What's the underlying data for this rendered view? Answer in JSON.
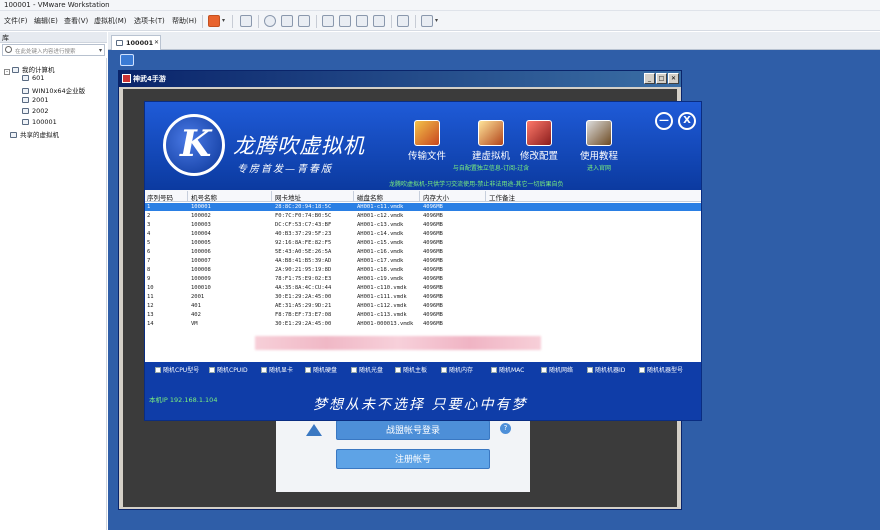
{
  "window": {
    "title": "100001 - VMware Workstation"
  },
  "menu": [
    "文件(F)",
    "编辑(E)",
    "查看(V)",
    "虚拟机(M)",
    "选项卡(T)",
    "帮助(H)"
  ],
  "library": {
    "header": "库",
    "search_placeholder": "在此处键入内容进行搜索",
    "tree": [
      {
        "label": "我的计算机"
      },
      {
        "label": "601"
      },
      {
        "label": "WIN10x64企业版"
      },
      {
        "label": "2001"
      },
      {
        "label": "2002"
      },
      {
        "label": "100001"
      },
      {
        "label": "共享的虚拟机"
      }
    ]
  },
  "vm_tab": {
    "label": "100001"
  },
  "inner_window": {
    "title": "神武4手游",
    "login_button": "战盟帐号登录",
    "register_button": "注册帐号",
    "help_icon": "?"
  },
  "app": {
    "brand_title": "龙腾吹虚拟机",
    "brand_subtitle": "专房首发—青春版",
    "features": [
      {
        "label": "传输文件",
        "sub": ""
      },
      {
        "label": "建虚拟机",
        "sub": "与自配置独立信息-订阅-过含"
      },
      {
        "label": "修改配置",
        "sub": ""
      },
      {
        "label": "使用教程",
        "sub": "进入官网"
      }
    ],
    "ticker": "龙腾吹虚拟机-只供学习交流使用-禁止非法用途-其它一切后果自负",
    "min_icon": "—",
    "close_icon": "X",
    "columns": [
      "序列号码",
      "机号名称",
      "网卡地址",
      "磁盘名称",
      "内存大小",
      "工作备注"
    ],
    "rows": [
      [
        "1",
        "100001",
        "28:8C:20:94:18:5C",
        "AH001-c11.vmdk",
        "4096MB",
        ""
      ],
      [
        "2",
        "100002",
        "F0:7C:F0:74:B0:5C",
        "AH001-c12.vmdk",
        "4096MB",
        ""
      ],
      [
        "3",
        "100003",
        "DC:CF:53:C7:43:BF",
        "AH001-c13.vmdk",
        "4096MB",
        ""
      ],
      [
        "4",
        "100004",
        "40:B3:37:29:5F:23",
        "AH001-c14.vmdk",
        "4096MB",
        ""
      ],
      [
        "5",
        "100005",
        "92:16:8A:FE:82:F5",
        "AH001-c15.vmdk",
        "4096MB",
        ""
      ],
      [
        "6",
        "100006",
        "5E:43:A0:5E:26:5A",
        "AH001-c16.vmdk",
        "4096MB",
        ""
      ],
      [
        "7",
        "100007",
        "4A:B8:41:B5:39:AD",
        "AH001-c17.vmdk",
        "4096MB",
        ""
      ],
      [
        "8",
        "100008",
        "2A:90:21:95:19:8D",
        "AH001-c18.vmdk",
        "4096MB",
        ""
      ],
      [
        "9",
        "100009",
        "78:F1:75:E9:02:E3",
        "AH001-c19.vmdk",
        "4096MB",
        ""
      ],
      [
        "10",
        "100010",
        "4A:35:8A:4C:CU:44",
        "AH001-c110.vmdk",
        "4096MB",
        ""
      ],
      [
        "11",
        "2001",
        "30:E1:29:2A:45:00",
        "AH001-c111.vmdk",
        "4096MB",
        ""
      ],
      [
        "12",
        "401",
        "AE:31:A5:29:9D:21",
        "AH001-c112.vmdk",
        "4096MB",
        ""
      ],
      [
        "13",
        "402",
        "F8:7B:EF:73:E7:08",
        "AH001-c113.vmdk",
        "4096MB",
        ""
      ],
      [
        "14",
        "VM",
        "30:E1:29:2A:45:00",
        "AH001-000013.vmdk",
        "4096MB",
        ""
      ]
    ],
    "checkboxes": [
      "随机CPU型号",
      "随机CPUID",
      "随机显卡",
      "随机硬盘",
      "随机光盘",
      "随机主板",
      "随机内存",
      "随机MAC",
      "随机网络",
      "随机机器ID",
      "随机机器型号"
    ],
    "ip_line": "本机IP 192.168.1.104",
    "slogan": "梦想从未不选择 只要心中有梦"
  }
}
